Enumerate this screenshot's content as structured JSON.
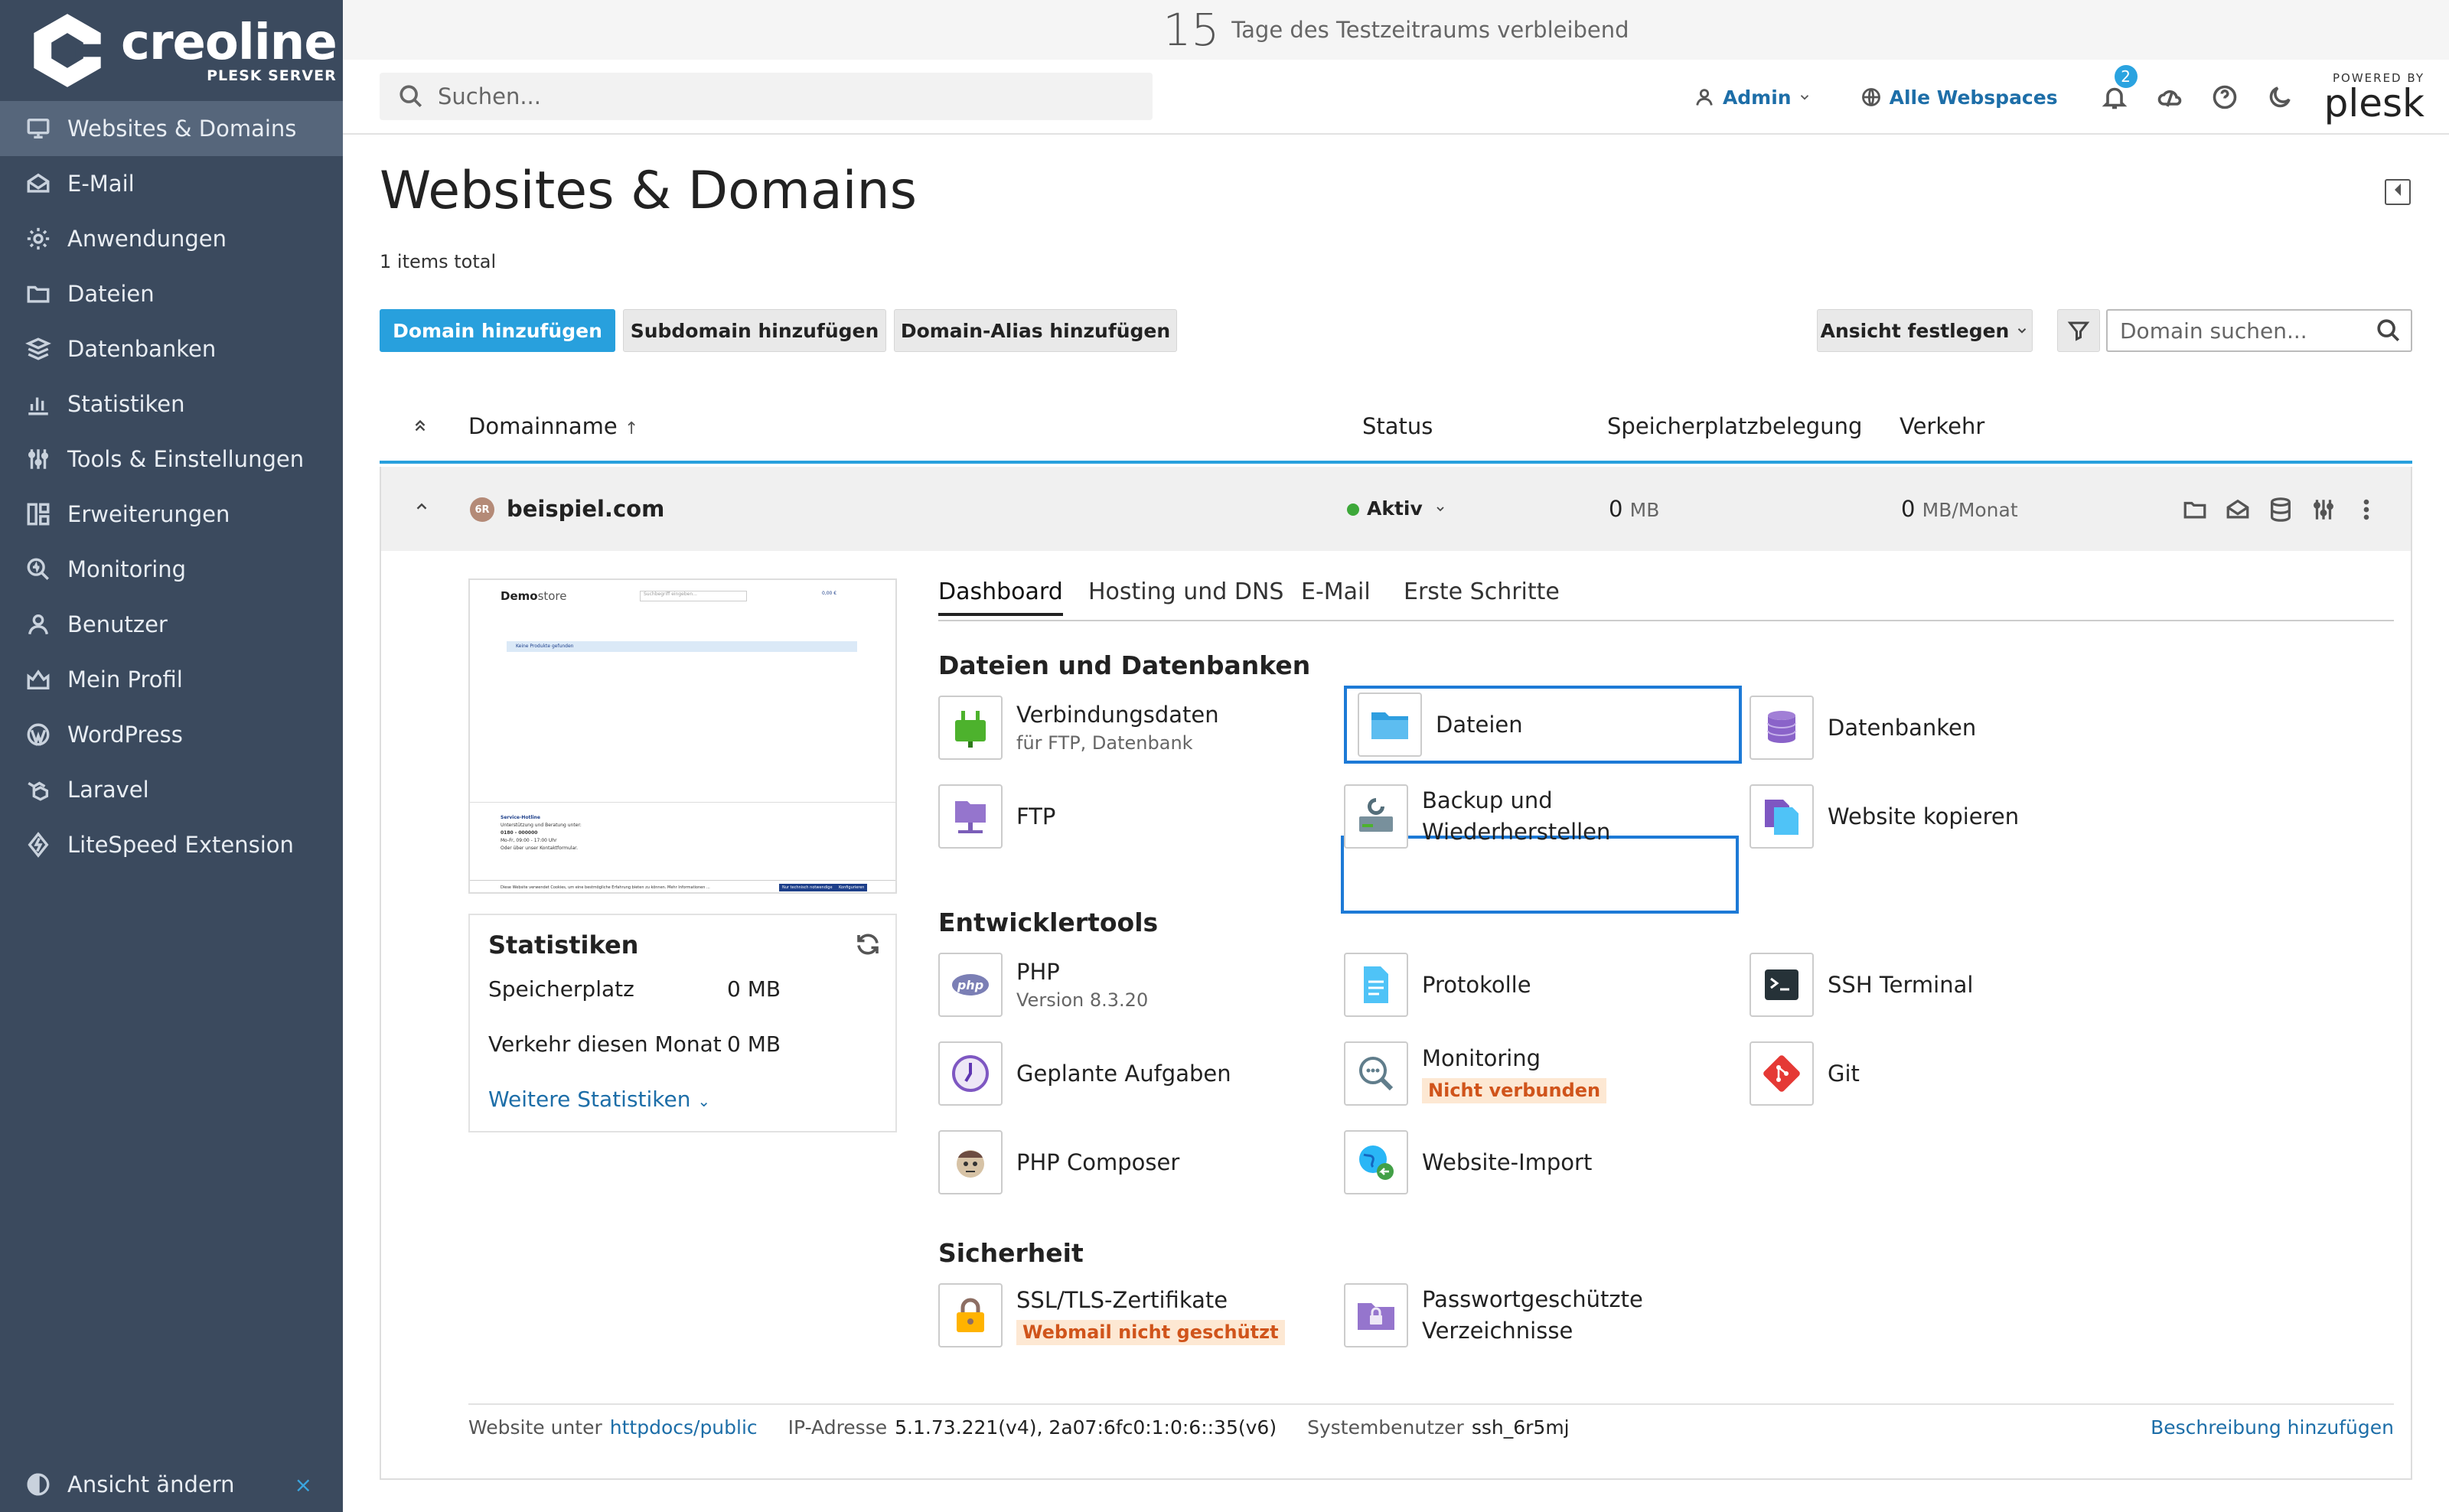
{
  "brand": {
    "name": "creoline",
    "sub": "PLESK SERVER"
  },
  "sidebar": {
    "items": [
      {
        "label": "Websites & Domains",
        "icon": "monitor-icon"
      },
      {
        "label": "E-Mail",
        "icon": "mail-icon"
      },
      {
        "label": "Anwendungen",
        "icon": "gear-icon"
      },
      {
        "label": "Dateien",
        "icon": "folder-icon"
      },
      {
        "label": "Datenbanken",
        "icon": "database-icon"
      },
      {
        "label": "Statistiken",
        "icon": "bar-chart-icon"
      },
      {
        "label": "Tools & Einstellungen",
        "icon": "sliders-icon"
      },
      {
        "label": "Erweiterungen",
        "icon": "extensions-icon"
      },
      {
        "label": "Monitoring",
        "icon": "monitoring-icon"
      },
      {
        "label": "Benutzer",
        "icon": "user-icon"
      },
      {
        "label": "Mein Profil",
        "icon": "profile-icon"
      },
      {
        "label": "WordPress",
        "icon": "wordpress-icon"
      },
      {
        "label": "Laravel",
        "icon": "laravel-icon"
      },
      {
        "label": "LiteSpeed Extension",
        "icon": "litespeed-icon"
      }
    ],
    "bottom": "Ansicht ändern",
    "close": "×"
  },
  "trial": {
    "days": "15",
    "text": "Tage des Testzeitraums verbleibend"
  },
  "topbar": {
    "search_placeholder": "Suchen...",
    "user": "Admin",
    "webspaces": "Alle Webspaces",
    "notifications": "2",
    "powered": "POWERED BY",
    "plesk": "plesk"
  },
  "page": {
    "title": "Websites & Domains",
    "items_total": "1 items total",
    "buttons": {
      "add_domain": "Domain hinzufügen",
      "add_subdomain": "Subdomain hinzufügen",
      "add_alias": "Domain-Alias hinzufügen",
      "view": "Ansicht festlegen"
    },
    "domain_search_placeholder": "Domain suchen..."
  },
  "table": {
    "headers": {
      "name": "Domainname",
      "status": "Status",
      "storage": "Speicherplatzbelegung",
      "traffic": "Verkehr"
    },
    "row": {
      "avatar": "6R",
      "domain": "beispiel.com",
      "status": "Aktiv",
      "storage_value": "0",
      "storage_unit": "MB",
      "traffic_value": "0",
      "traffic_unit": "MB/Monat"
    }
  },
  "preview": {
    "brand_bold": "Demo",
    "brand_light": "store",
    "search": "Suchbegriff eingeben...",
    "cart": "0,00 €",
    "notice": "Keine Produkte gefunden",
    "footer_title": "Service-Hotline",
    "footer_line1": "Unterstützung und Beratung unter:",
    "footer_phone": "0180 - 000000",
    "footer_hours": "Mo-Fr, 09:00 - 17:00 Uhr",
    "footer_mail": "Oder über unser Kontaktformular.",
    "cookie_text": "Diese Website verwendet Cookies, um eine bestmögliche Erfahrung bieten zu können. Mehr Informationen ...",
    "cookie_btn1": "Nur technisch notwendige",
    "cookie_btn2": "Konfigurieren"
  },
  "stats": {
    "title": "Statistiken",
    "storage_label": "Speicherplatz",
    "storage_value": "0 MB",
    "traffic_label": "Verkehr diesen Monat",
    "traffic_value": "0 MB",
    "more": "Weitere Statistiken"
  },
  "tabs": [
    "Dashboard",
    "Hosting und DNS",
    "E-Mail",
    "Erste Schritte"
  ],
  "sections": {
    "files": {
      "title": "Dateien und Datenbanken",
      "tiles": [
        {
          "title": "Verbindungsdaten",
          "sub": "für FTP, Datenbank",
          "icon": "plug-icon"
        },
        {
          "title": "Dateien",
          "sub": "",
          "icon": "folder-icon"
        },
        {
          "title": "Datenbanken",
          "sub": "",
          "icon": "database-icon"
        },
        {
          "title": "FTP",
          "sub": "",
          "icon": "ftp-icon"
        },
        {
          "title": "Backup und Wiederherstellen",
          "sub": "",
          "icon": "backup-icon"
        },
        {
          "title": "Website kopieren",
          "sub": "",
          "icon": "copy-icon"
        }
      ]
    },
    "dev": {
      "title": "Entwicklertools",
      "tiles": [
        {
          "title": "PHP",
          "sub": "Version 8.3.20",
          "icon": "php-icon"
        },
        {
          "title": "Protokolle",
          "sub": "",
          "icon": "logs-icon"
        },
        {
          "title": "SSH Terminal",
          "sub": "",
          "icon": "terminal-icon"
        },
        {
          "title": "Geplante Aufgaben",
          "sub": "",
          "icon": "clock-icon"
        },
        {
          "title": "Monitoring",
          "warn": "Nicht verbunden",
          "icon": "monitoring-icon"
        },
        {
          "title": "Git",
          "sub": "",
          "icon": "git-icon"
        },
        {
          "title": "PHP Composer",
          "sub": "",
          "icon": "composer-icon"
        },
        {
          "title": "Website-Import",
          "sub": "",
          "icon": "globe-import-icon"
        }
      ]
    },
    "security": {
      "title": "Sicherheit",
      "tiles": [
        {
          "title": "SSL/TLS-Zertifikate",
          "warn": "Webmail nicht geschützt",
          "icon": "lock-icon"
        },
        {
          "title": "Passwortgeschützte",
          "title2": "Verzeichnisse",
          "icon": "protected-folder-icon"
        }
      ]
    }
  },
  "footer": {
    "website_label": "Website unter",
    "website_path": "httpdocs/public",
    "ip_label": "IP-Adresse",
    "ip_value": "5.1.73.221(v4), 2a07:6fc0:1:0:6::35(v6)",
    "user_label": "Systembenutzer",
    "user_value": "ssh_6r5mj",
    "add_description": "Beschreibung hinzufügen"
  },
  "colors": {
    "sidebar": "#3b4a5e",
    "accent": "#28a0dd",
    "link": "#1d6ea8",
    "warn": "#d0541b",
    "active": "#3da839"
  }
}
